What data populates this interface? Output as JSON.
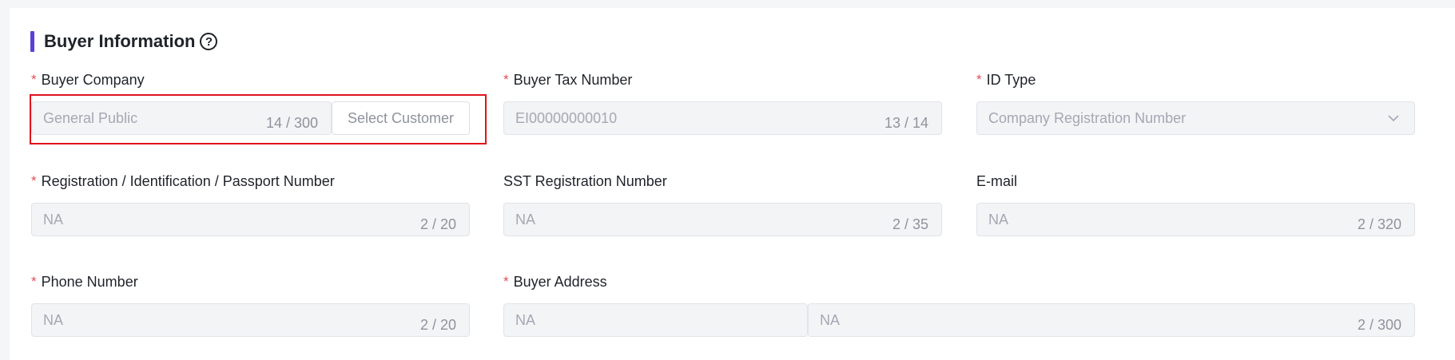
{
  "section": {
    "title": "Buyer Information",
    "help_icon": "question-circle-icon"
  },
  "colors": {
    "accent": "#5b3fd6",
    "required": "#e34d59",
    "highlight": "#e0131d"
  },
  "fields": {
    "buyer_company": {
      "label": "Buyer Company",
      "required": true,
      "placeholder": "General Public",
      "count": "14 / 300",
      "button": "Select Customer"
    },
    "buyer_tax_number": {
      "label": "Buyer Tax Number",
      "required": true,
      "value": "EI00000000010",
      "count": "13 / 14"
    },
    "id_type": {
      "label": "ID Type",
      "required": true,
      "value": "Company Registration Number",
      "icon": "chevron-down-icon"
    },
    "registration_number": {
      "label": "Registration / Identification / Passport Number",
      "required": true,
      "value": "NA",
      "count": "2 / 20"
    },
    "sst_number": {
      "label": "SST Registration Number",
      "required": false,
      "value": "NA",
      "count": "2 / 35"
    },
    "email": {
      "label": "E-mail",
      "required": false,
      "value": "NA",
      "count": "2 / 320"
    },
    "phone": {
      "label": "Phone Number",
      "required": true,
      "value": "NA",
      "count": "2 / 20"
    },
    "buyer_address": {
      "label": "Buyer Address",
      "required": true,
      "value_short": "NA",
      "value_long": "NA",
      "count": "2 / 300"
    }
  },
  "required_mark": "*"
}
